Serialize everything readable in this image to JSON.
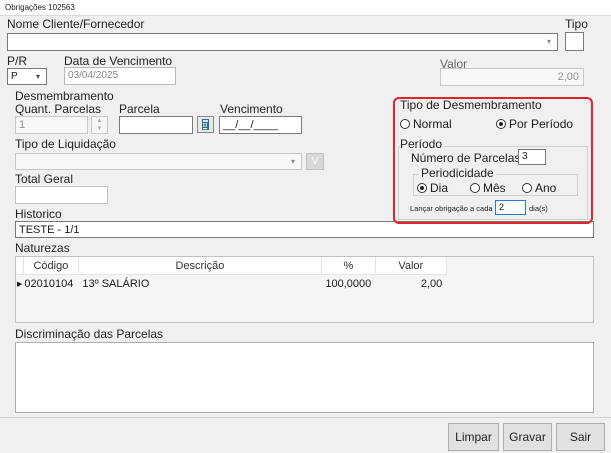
{
  "window": {
    "title": "Obrigações 102563"
  },
  "client": {
    "label": "Nome Cliente/Fornecedor",
    "value": ""
  },
  "tipo": {
    "label": "Tipo",
    "value": ""
  },
  "pr": {
    "label": "P/R",
    "value": "P"
  },
  "vencimento_data": {
    "label": "Data de Vencimento",
    "value": "03/04/2025"
  },
  "valor": {
    "label": "Valor",
    "value": "2,00"
  },
  "desmembramento": {
    "label": "Desmembramento",
    "quant_label": "Quant. Parcelas",
    "quant_value": "1",
    "parcela_label": "Parcela",
    "parcela_value": "",
    "vencimento_label": "Vencimento",
    "vencimento_value": "__/__/____"
  },
  "tipo_liquidacao": {
    "label": "Tipo de Liquidação",
    "value": "",
    "v_button": "V"
  },
  "total_geral": {
    "label": "Total Geral",
    "value": ""
  },
  "historico": {
    "label": "Historico",
    "value": "TESTE - 1/1"
  },
  "tipo_desmembramento": {
    "label": "Tipo de Desmembramento",
    "options": [
      {
        "label": "Normal",
        "selected": false
      },
      {
        "label": "Por Período",
        "selected": true
      }
    ]
  },
  "periodo": {
    "label": "Período",
    "numero_parcelas_label": "Número de Parcelas",
    "numero_parcelas_value": "3",
    "periodicidade_label": "Periodicidade",
    "periodicidade_options": [
      {
        "label": "Dia",
        "selected": true
      },
      {
        "label": "Mês",
        "selected": false
      },
      {
        "label": "Ano",
        "selected": false
      }
    ],
    "lancar_label": "Lançar obrigação a cada",
    "lancar_value": "2",
    "lancar_unit": "dia(s)"
  },
  "naturezas": {
    "label": "Naturezas",
    "columns": [
      "Código",
      "Descrição",
      "%",
      "Valor"
    ],
    "rows": [
      {
        "codigo": "02010104",
        "descricao": "13º SALÁRIO",
        "percent": "100,0000",
        "valor": "2,00"
      }
    ]
  },
  "discriminacao": {
    "label": "Discriminação das Parcelas"
  },
  "buttons": {
    "limpar": "Limpar",
    "gravar": "Gravar",
    "sair": "Sair"
  },
  "colors": {
    "highlight": "#e0222a",
    "window_bg": "#f0f0f0"
  }
}
